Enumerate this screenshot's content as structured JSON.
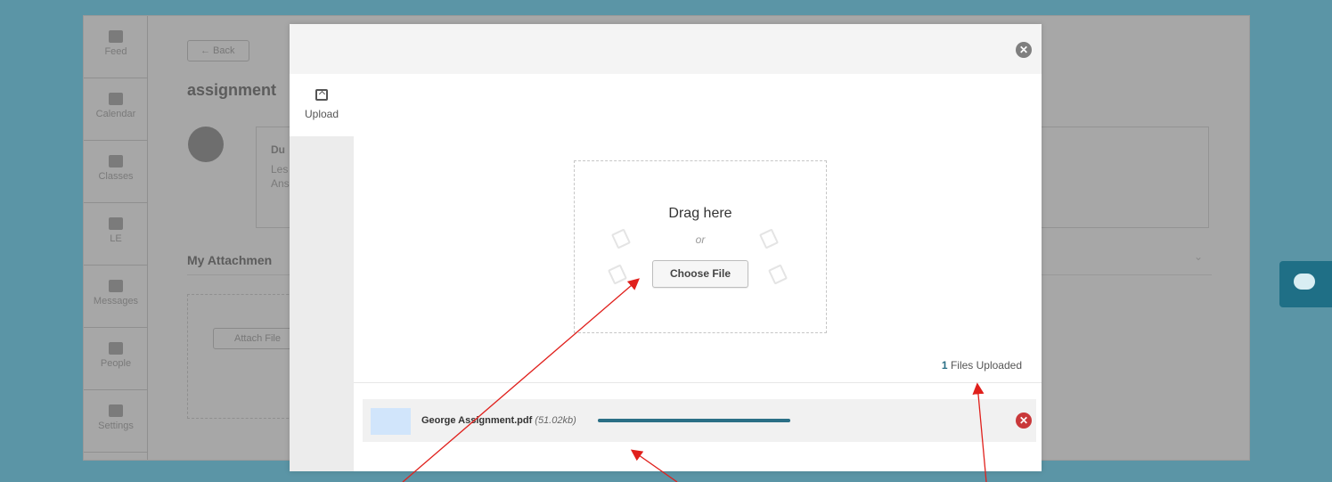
{
  "sidebar": {
    "items": [
      {
        "label": "Feed",
        "icon": "feed-icon"
      },
      {
        "label": "Calendar",
        "icon": "calendar-icon"
      },
      {
        "label": "Classes",
        "icon": "classes-icon"
      },
      {
        "label": "LE",
        "icon": "piggy-bank-icon"
      },
      {
        "label": "Messages",
        "icon": "envelope-icon"
      },
      {
        "label": "People",
        "icon": "person-icon"
      },
      {
        "label": "Settings",
        "icon": "gear-icon"
      }
    ]
  },
  "page": {
    "back_label": "← Back",
    "title": "assignment",
    "comment": {
      "name": "Du",
      "line1": "Les",
      "line2": "Ans"
    },
    "attachments_title": "My Attachmen",
    "attach_button": "Attach File"
  },
  "modal": {
    "tabs": [
      {
        "label": "Upload",
        "icon": "upload-icon"
      }
    ],
    "dropzone": {
      "drag_text": "Drag here",
      "or_text": "or",
      "choose_label": "Choose File"
    },
    "files_count": "1",
    "files_uploaded_label": "Files Uploaded",
    "files": [
      {
        "name": "George Assignment.pdf",
        "size": "(51.02kb)",
        "progress": 1.0
      }
    ]
  },
  "colors": {
    "accent": "#2a6f86",
    "remove": "#c9383a",
    "backdrop": "#5b95a6"
  }
}
